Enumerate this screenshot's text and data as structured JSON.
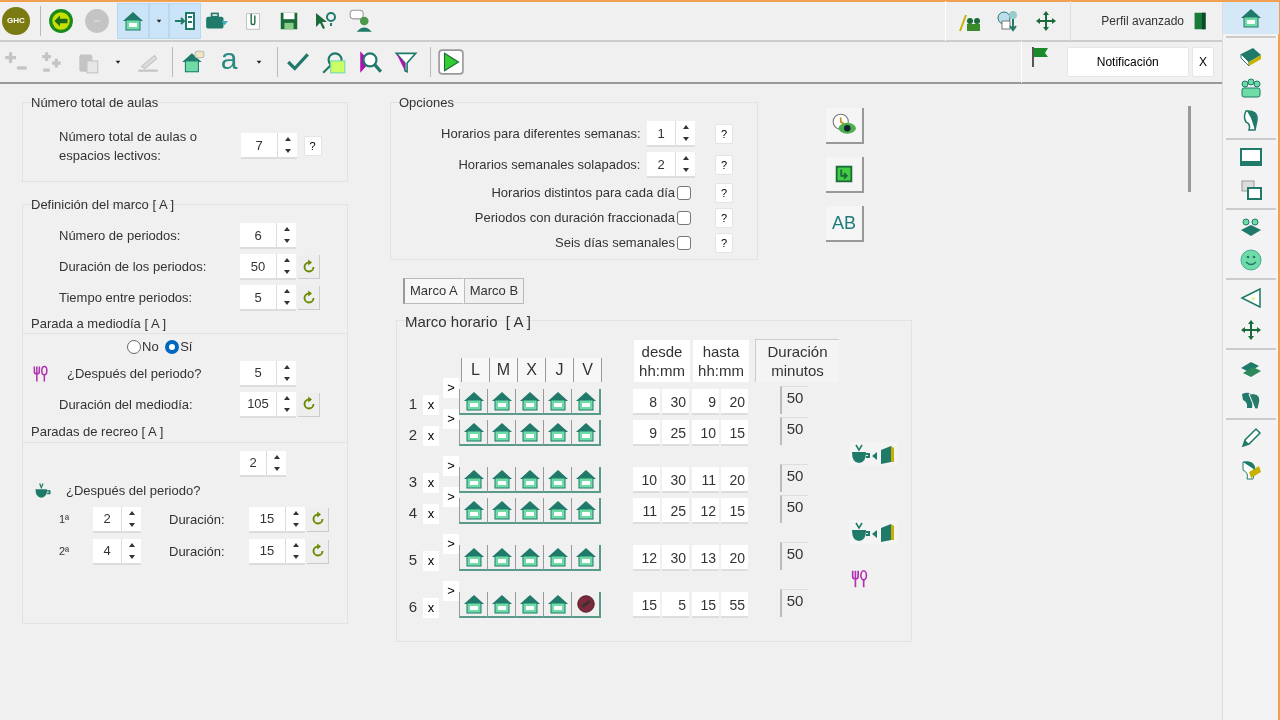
{
  "top_toolbar": {
    "logo": "GHC",
    "buttons": [
      {
        "selected": false,
        "disabled": false
      },
      {
        "selected": false,
        "disabled": true
      },
      {
        "selected": true,
        "disabled": false
      },
      {
        "selected": true,
        "disabled": false
      },
      {
        "selected": true,
        "disabled": false
      },
      {
        "selected": false,
        "disabled": false
      },
      {
        "selected": false,
        "disabled": false
      },
      {
        "selected": false,
        "disabled": false
      },
      {
        "selected": false,
        "disabled": false
      },
      {
        "selected": false,
        "disabled": false
      }
    ],
    "profile": "Perfil avanzado"
  },
  "second_toolbar": {
    "buttons": [
      {
        "disabled": true
      },
      {
        "disabled": true
      },
      {
        "disabled": true
      },
      {
        "disabled": false
      },
      {
        "disabled": true
      },
      {
        "disabled": false
      },
      {
        "disabled": false,
        "label": "a"
      },
      {
        "disabled": false
      },
      {
        "disabled": false
      },
      {
        "disabled": false
      },
      {
        "disabled": false
      },
      {
        "disabled": false
      },
      {
        "disabled": false
      }
    ],
    "notification": "Notificación",
    "close": "X"
  },
  "sidebar": [
    {
      "selected": true
    },
    {
      "selected": false
    },
    {
      "selected": false
    },
    {
      "selected": false
    },
    {
      "selected": false
    },
    {
      "selected": false
    },
    {
      "selected": false
    },
    {
      "selected": false
    },
    {
      "selected": false
    },
    {
      "selected": false
    },
    {
      "selected": false
    },
    {
      "selected": false
    },
    {
      "selected": false
    },
    {
      "selected": false
    }
  ],
  "aulas": {
    "legend": "Número total de aulas",
    "label": "Número total de aulas o espacios lectivos:",
    "value": "7",
    "help": "?"
  },
  "marco": {
    "legend": "Definición del marco [ A ]",
    "fields": [
      {
        "label": "Número de periodos:",
        "value": "6",
        "reset": false
      },
      {
        "label": "Duración de los periodos:",
        "value": "50",
        "reset": true
      },
      {
        "label": "Tiempo entre periodos:",
        "value": "5",
        "reset": true
      }
    ]
  },
  "mediodia": {
    "legend": "Parada a mediodía [ A ]",
    "options": [
      {
        "label": "No",
        "selected": false
      },
      {
        "label": "Sí",
        "selected": true
      }
    ],
    "fields": [
      {
        "label": "¿Después del periodo?",
        "value": "5",
        "reset": false
      },
      {
        "label": "Duración del mediodía:",
        "value": "105",
        "reset": true
      }
    ]
  },
  "recreo": {
    "legend": "Paradas de recreo [ A ]",
    "count": "2",
    "label": "¿Después del periodo?",
    "breaks": [
      {
        "ordinal": "1ª",
        "period": "2",
        "duration_label": "Duración:",
        "duration": "15"
      },
      {
        "ordinal": "2ª",
        "period": "4",
        "duration_label": "Duración:",
        "duration": "15"
      }
    ]
  },
  "opciones": {
    "legend": "Opciones",
    "spinners": [
      {
        "label": "Horarios para diferentes semanas:",
        "value": "1",
        "help": "?"
      },
      {
        "label": "Horarios semanales solapados:",
        "value": "2",
        "help": "?"
      }
    ],
    "checks": [
      {
        "label": "Horarios distintos para cada día",
        "checked": false,
        "help": "?"
      },
      {
        "label": "Periodos con duración fraccionada",
        "checked": false,
        "help": "?"
      },
      {
        "label": "Seis días semanales",
        "checked": false,
        "help": "?"
      }
    ]
  },
  "ab_button": "AB",
  "tabs": [
    {
      "label": "Marco A",
      "selected": true
    },
    {
      "label": "Marco B",
      "selected": false
    }
  ],
  "timetable": {
    "title": "Marco horario  [ A ]",
    "days": [
      "L",
      "M",
      "X",
      "J",
      "V"
    ],
    "from_header": [
      "desde",
      "hh:mm"
    ],
    "to_header": [
      "hasta",
      "hh:mm"
    ],
    "duration_header": [
      "Duración",
      "minutos"
    ],
    "rows": [
      {
        "kind": "period",
        "number": "1",
        "delete": "x",
        "copy": ">",
        "days": [
          {
            "blocked": false
          },
          {
            "blocked": false
          },
          {
            "blocked": false
          },
          {
            "blocked": false
          },
          {
            "blocked": false
          }
        ],
        "from": [
          "8",
          "30"
        ],
        "to": [
          "9",
          "20"
        ],
        "duration": "50"
      },
      {
        "kind": "period",
        "number": "2",
        "delete": "x",
        "copy": ">",
        "days": [
          {
            "blocked": false
          },
          {
            "blocked": false
          },
          {
            "blocked": false
          },
          {
            "blocked": false
          },
          {
            "blocked": false
          }
        ],
        "from": [
          "9",
          "25"
        ],
        "to": [
          "10",
          "15"
        ],
        "duration": "50"
      },
      {
        "kind": "recess"
      },
      {
        "kind": "period",
        "number": "3",
        "delete": "x",
        "copy": ">",
        "days": [
          {
            "blocked": false
          },
          {
            "blocked": false
          },
          {
            "blocked": false
          },
          {
            "blocked": false
          },
          {
            "blocked": false
          }
        ],
        "from": [
          "10",
          "30"
        ],
        "to": [
          "11",
          "20"
        ],
        "duration": "50"
      },
      {
        "kind": "period",
        "number": "4",
        "delete": "x",
        "copy": ">",
        "days": [
          {
            "blocked": false
          },
          {
            "blocked": false
          },
          {
            "blocked": false
          },
          {
            "blocked": false
          },
          {
            "blocked": false
          }
        ],
        "from": [
          "11",
          "25"
        ],
        "to": [
          "12",
          "15"
        ],
        "duration": "50"
      },
      {
        "kind": "recess"
      },
      {
        "kind": "period",
        "number": "5",
        "delete": "x",
        "copy": ">",
        "days": [
          {
            "blocked": false
          },
          {
            "blocked": false
          },
          {
            "blocked": false
          },
          {
            "blocked": false
          },
          {
            "blocked": false
          }
        ],
        "from": [
          "12",
          "30"
        ],
        "to": [
          "13",
          "20"
        ],
        "duration": "50"
      },
      {
        "kind": "lunch"
      },
      {
        "kind": "period",
        "number": "6",
        "delete": "x",
        "copy": ">",
        "days": [
          {
            "blocked": false
          },
          {
            "blocked": false
          },
          {
            "blocked": false
          },
          {
            "blocked": false
          },
          {
            "blocked": true
          }
        ],
        "from": [
          "15",
          "5"
        ],
        "to": [
          "15",
          "55"
        ],
        "duration": "50"
      }
    ]
  }
}
